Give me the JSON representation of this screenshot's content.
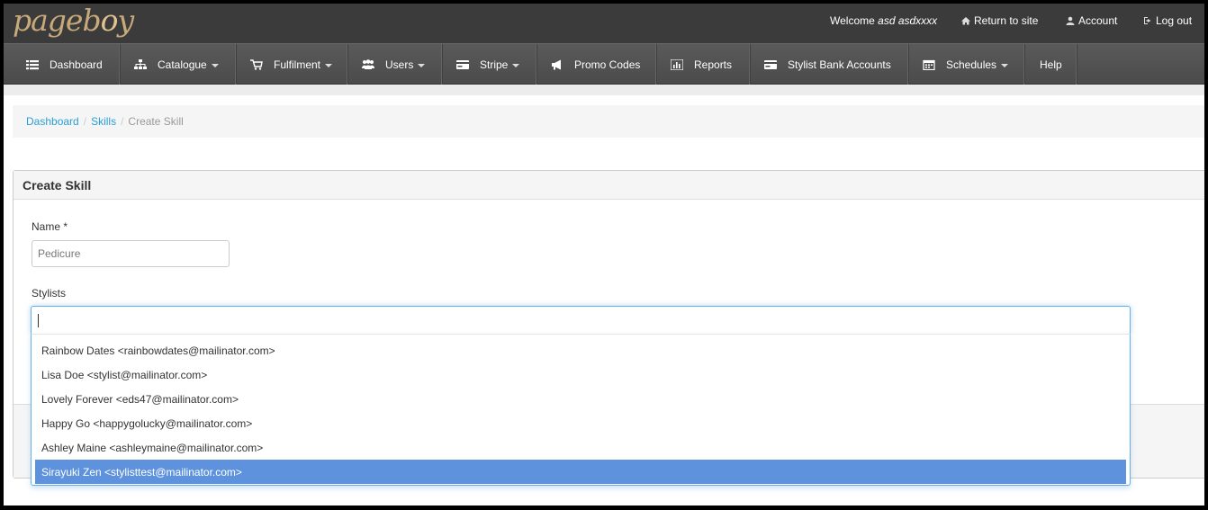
{
  "brand": {
    "logo_text_a": "pageb",
    "logo_text_o": "o",
    "logo_text_b": "y"
  },
  "topbar": {
    "welcome_prefix": "Welcome",
    "user_name": "asd asdxxxx",
    "return_label": "Return to site",
    "account_label": "Account",
    "logout_label": "Log out"
  },
  "nav": {
    "dashboard": "Dashboard",
    "catalogue": "Catalogue",
    "fulfilment": "Fulfilment",
    "users": "Users",
    "stripe": "Stripe",
    "promo_codes": "Promo Codes",
    "reports": "Reports",
    "stylist_bank_accounts": "Stylist Bank Accounts",
    "schedules": "Schedules",
    "help": "Help"
  },
  "breadcrumb": {
    "dashboard": "Dashboard",
    "skills": "Skills",
    "current": "Create Skill",
    "separator": "/"
  },
  "panel": {
    "title": "Create Skill"
  },
  "form": {
    "name_label": "Name *",
    "name_placeholder": "Pedicure",
    "stylists_label": "Stylists"
  },
  "stylists": {
    "options": [
      "Rainbow Dates <rainbowdates@mailinator.com>",
      "Lisa Doe <stylist@mailinator.com>",
      "Lovely Forever <eds47@mailinator.com>",
      "Happy Go <happygolucky@mailinator.com>",
      "Ashley Maine <ashleymaine@mailinator.com>",
      "Sirayuki Zen <stylisttest@mailinator.com>"
    ],
    "highlighted_index": 5
  },
  "colors": {
    "link": "#2a9fd6",
    "highlight": "#5e92dd",
    "nav_bg": "#4b4b4b",
    "top_bg": "#3b3b3b"
  }
}
